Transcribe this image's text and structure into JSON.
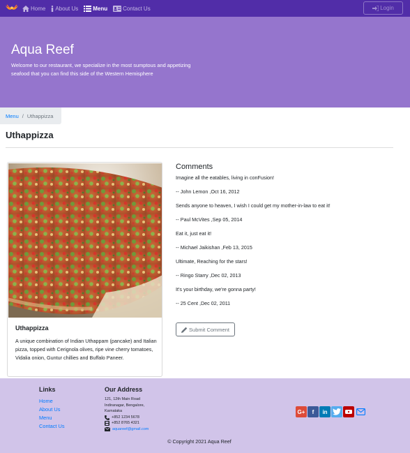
{
  "nav": {
    "items": [
      {
        "label": "Home",
        "icon": "home-icon"
      },
      {
        "label": "About Us",
        "icon": "info-icon"
      },
      {
        "label": "Menu",
        "icon": "list-icon",
        "active": true
      },
      {
        "label": "Contact Us",
        "icon": "address-card-icon"
      }
    ],
    "login_label": "Login"
  },
  "jumbotron": {
    "title": "Aqua Reef",
    "text": "Welcome to our restaurant, we specialize in the most sumptous and appetizing seafood that you can find this side of the Western Hemisphere"
  },
  "breadcrumb": {
    "link": "Menu",
    "separator": "/",
    "active": "Uthappizza"
  },
  "page_title": "Uthappizza",
  "dish": {
    "name": "Uthappizza",
    "description": "A unique combination of Indian Uthappam (pancake) and Italian pizza, topped with Cerignola olives, ripe vine cherry tomatoes, Vidalia onion, Guntur chillies and Buffalo Paneer."
  },
  "comments": {
    "heading": "Comments",
    "items": [
      {
        "text": "Imagine all the eatables, living in conFusion!",
        "author": "-- John Lemon ,Oct 16, 2012"
      },
      {
        "text": "Sends anyone to heaven, I wish I could get my mother-in-law to eat it!",
        "author": "-- Paul McVites ,Sep 05, 2014"
      },
      {
        "text": "Eat it, just eat it!",
        "author": "-- Michael Jaikishan ,Feb 13, 2015"
      },
      {
        "text": "Ultimate, Reaching for the stars!",
        "author": "-- Ringo Starry ,Dec 02, 2013"
      },
      {
        "text": "It's your birthday, we're gonna party!",
        "author": "-- 25 Cent ,Dec 02, 2011"
      }
    ],
    "submit_label": "Submit Comment"
  },
  "footer": {
    "links_title": "Links",
    "links": [
      "Home",
      "About Us",
      "Menu",
      "Contact Us"
    ],
    "address_title": "Our Address",
    "address_lines": [
      "121, 12th Main Road",
      "Indiranagar, Bengalore,",
      "Karnataka"
    ],
    "phone": "+852 1234 5678",
    "fax": "+852 8765 4321",
    "email": "aquareef@gmail.com",
    "copyright": "© Copyright 2021 Aqua Reef"
  },
  "colors": {
    "navbar": "#512da8",
    "jumbotron": "#9575cd",
    "footer": "#d1c4e9",
    "link": "#007bff"
  }
}
